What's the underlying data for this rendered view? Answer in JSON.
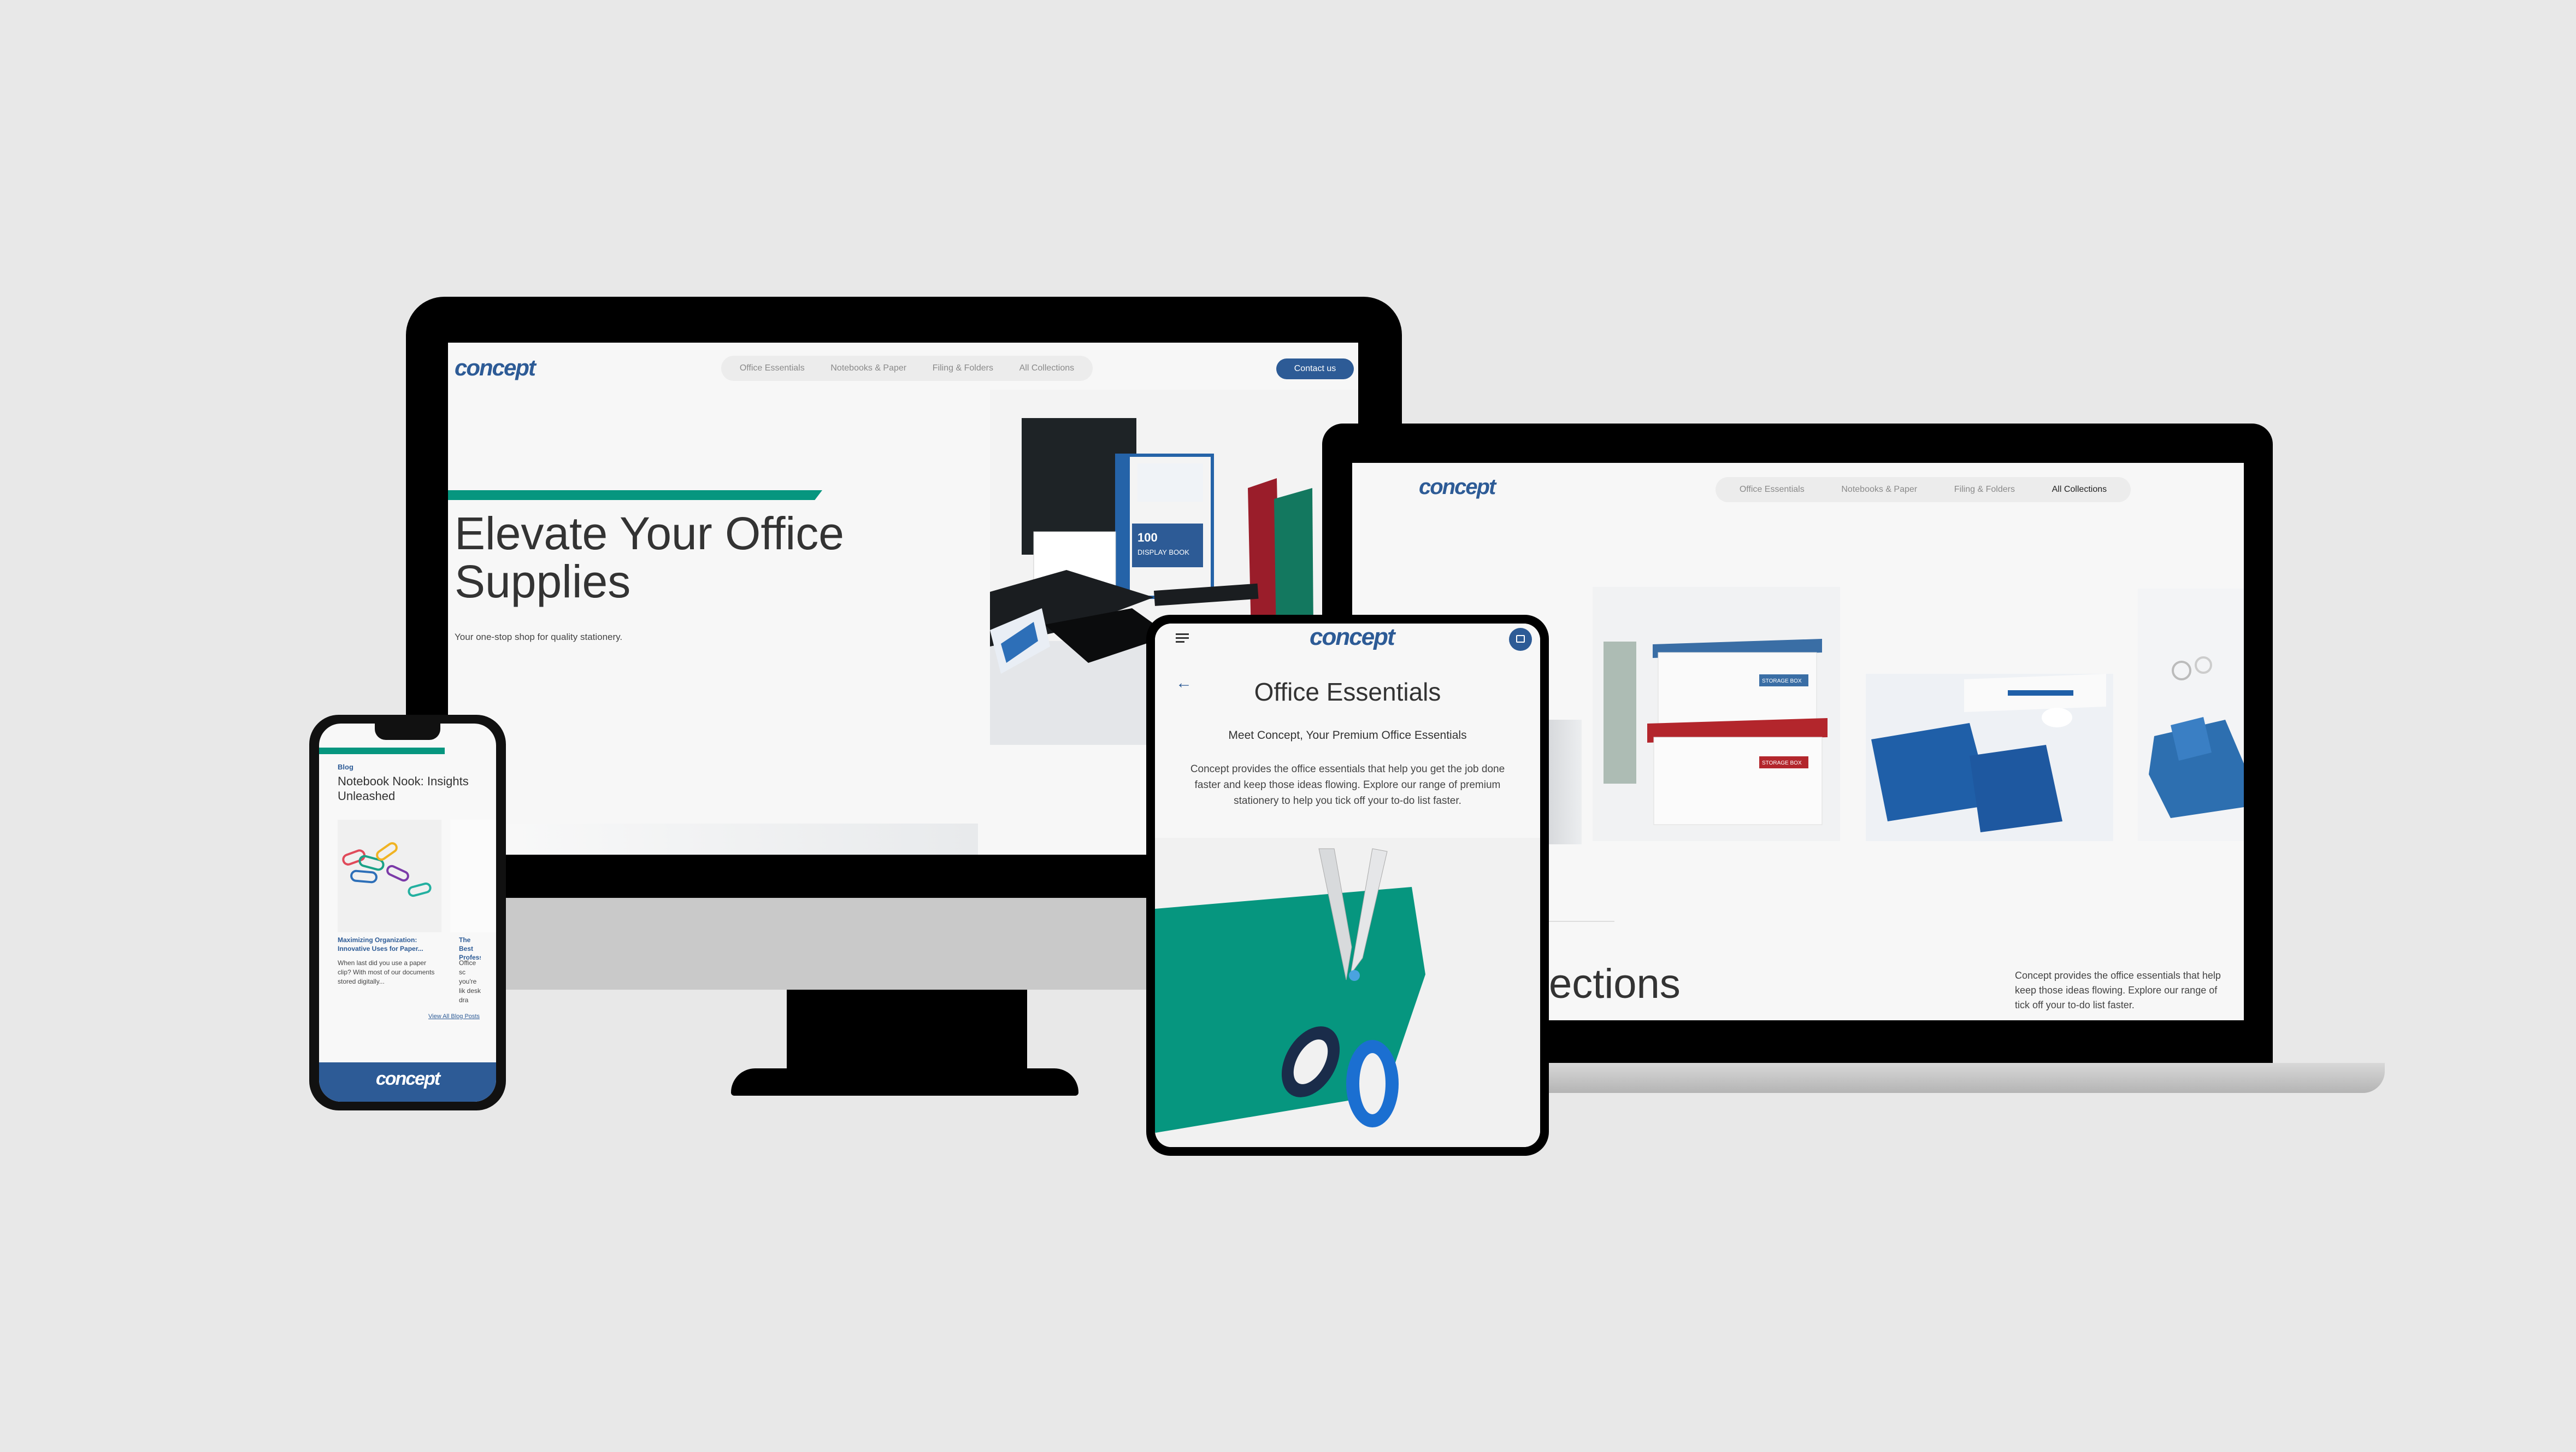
{
  "brand": {
    "logo": "concept",
    "teal": "#06967f",
    "blue": "#2d5b96"
  },
  "desktop": {
    "nav": [
      "Office Essentials",
      "Notebooks & Paper",
      "Filing & Folders",
      "All Collections"
    ],
    "contact_label": "Contact us",
    "hero_title_line1": "Elevate Your Office",
    "hero_title_line2": "Supplies",
    "hero_subtitle": "Your one-stop shop for quality stationery.",
    "product_label_count": "100",
    "product_label_name": "DISPLAY BOOK"
  },
  "laptop": {
    "nav": [
      "Office Essentials",
      "Notebooks & Paper",
      "Filing & Folders",
      "All Collections"
    ],
    "heading_fragment": "ections",
    "body_line1": "Concept provides the office essentials that help",
    "body_line2": "keep those ideas flowing. Explore our range of",
    "body_line3": "tick off your to-do list faster.",
    "box_label_1": "STORAGE BOX",
    "box_label_2": "STORAGE BOX"
  },
  "tablet": {
    "menu_icon": "hamburger-icon",
    "cart_icon": "cart-icon",
    "back_icon": "back-arrow-icon",
    "title": "Office Essentials",
    "subtitle": "Meet Concept, Your Premium Office Essentials",
    "body": "Concept provides the office essentials that help you get the job done faster and keep those ideas flowing. Explore our range of premium stationery to help you tick off your to-do list faster."
  },
  "phone": {
    "section_label": "Blog",
    "title": "Notebook Nook: Insights Unleashed",
    "post1_title": "Maximizing Organization: Innovative Uses for Paper...",
    "post1_excerpt": "When last did you use a paper clip? With most of our documents stored digitally...",
    "post2_title": "The Best Professi",
    "post2_excerpt": "Office sc you're lik desk dra",
    "view_all": "View All Blog Posts"
  }
}
